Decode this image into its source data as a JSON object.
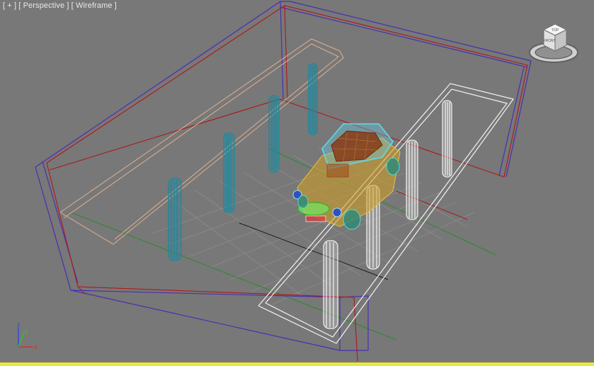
{
  "viewport": {
    "label_plus": "[ + ]",
    "label_view": "[ Perspective ]",
    "label_shading": "[ Wireframe ]",
    "background_color": "#787878"
  },
  "viewcube": {
    "top_label": "TOP",
    "front_label": "FRONT"
  },
  "axis_tripod": {
    "x": "x",
    "y": "y",
    "z": "z"
  },
  "colors": {
    "room_outline": "#4a2fb0",
    "room_inner": "#b01818",
    "ceiling_light": "#e0b090",
    "column_teal": "#1a8aa0",
    "column_white": "#f2f2f2",
    "grid": "#8c8c8c",
    "grid_axis": "#2a8a2a",
    "car_body": "#d4a020",
    "car_roof": "#60d8f0",
    "car_seats": "#8a3a14",
    "status_bar": "#e8e83a"
  },
  "icons": {
    "viewcube": "viewcube-icon",
    "axis": "axis-tripod-icon"
  }
}
